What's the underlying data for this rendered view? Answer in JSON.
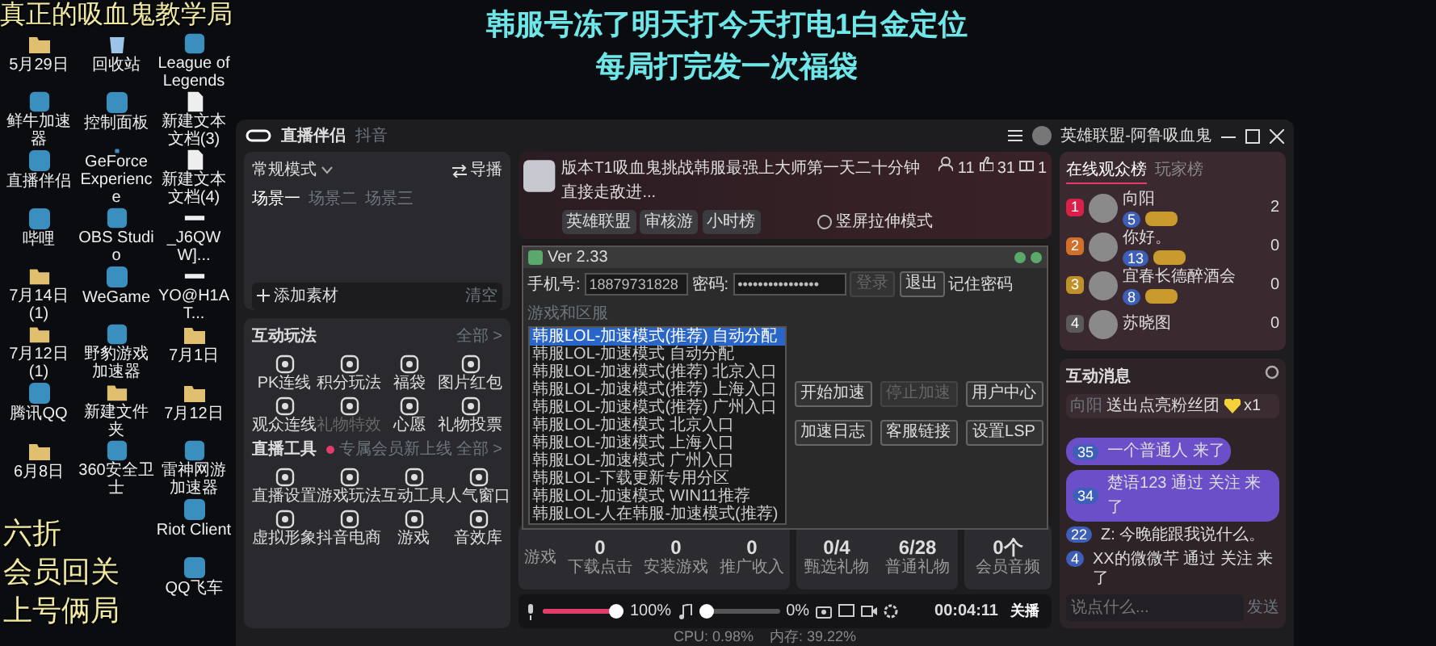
{
  "desktop": {
    "caption_top": "真正的吸血鬼教学局",
    "captions_bottom": [
      "六折",
      "会员回关",
      "上号俩局"
    ],
    "banner": [
      "韩服号冻了明天打今天打电1白金定位",
      "每局打完发一次福袋"
    ],
    "icon_columns": [
      [
        {
          "label": "5月29日",
          "kind": "folder"
        },
        {
          "label": "鲜牛加速器",
          "kind": "app"
        },
        {
          "label": "直播伴侣",
          "kind": "app"
        },
        {
          "label": "哔哩",
          "kind": "app"
        },
        {
          "label": "7月14日(1)",
          "kind": "folder"
        },
        {
          "label": "7月12日(1)",
          "kind": "folder"
        },
        {
          "label": "腾讯QQ",
          "kind": "app"
        },
        {
          "label": "6月8日",
          "kind": "folder"
        }
      ],
      [
        {
          "label": "回收站",
          "kind": "recycle"
        },
        {
          "label": "控制面板",
          "kind": "app"
        },
        {
          "label": "GeForce Experience",
          "kind": "app"
        },
        {
          "label": "OBS Studio",
          "kind": "app"
        },
        {
          "label": "WeGame",
          "kind": "app"
        },
        {
          "label": "野豹游戏加速器",
          "kind": "app"
        },
        {
          "label": "新建文件夹",
          "kind": "folder"
        },
        {
          "label": "360安全卫士",
          "kind": "app"
        }
      ],
      [
        {
          "label": "League of Legends",
          "kind": "app"
        },
        {
          "label": "新建文本文档(3)",
          "kind": "document"
        },
        {
          "label": "新建文本文档(4)",
          "kind": "document"
        },
        {
          "label": "_J6QWW]...",
          "kind": "file"
        },
        {
          "label": "YO@H1AT...",
          "kind": "file"
        },
        {
          "label": "7月1日",
          "kind": "folder"
        },
        {
          "label": "7月12日",
          "kind": "folder"
        },
        {
          "label": "雷神网游加速器",
          "kind": "app"
        },
        {
          "label": "Riot Client",
          "kind": "app"
        },
        {
          "label": "QQ飞车",
          "kind": "app"
        }
      ]
    ]
  },
  "app": {
    "title": "直播伴侣",
    "platform": "抖音",
    "room": "英雄联盟-阿鲁吸血鬼",
    "scene_card": {
      "mode": "常规模式",
      "director": "导播",
      "scenes": [
        {
          "label": "场景一",
          "selected": true
        },
        {
          "label": "场景二",
          "selected": false
        },
        {
          "label": "场景三",
          "selected": false
        }
      ],
      "add": "添加素材",
      "clear": "清空"
    },
    "interact": {
      "title": "互动玩法",
      "more": "全部 >",
      "items": [
        {
          "label": "PK连线",
          "disabled": false
        },
        {
          "label": "积分玩法",
          "disabled": false
        },
        {
          "label": "福袋",
          "disabled": false
        },
        {
          "label": "图片红包",
          "disabled": false
        },
        {
          "label": "观众连线",
          "disabled": false
        },
        {
          "label": "礼物特效",
          "disabled": true
        },
        {
          "label": "心愿",
          "disabled": false
        },
        {
          "label": "礼物投票",
          "disabled": false
        }
      ]
    },
    "tools": {
      "title": "直播工具",
      "notice": "专属会员新上线",
      "more": "全部 >",
      "items": [
        {
          "label": "直播设置"
        },
        {
          "label": "游戏玩法"
        },
        {
          "label": "互动工具"
        },
        {
          "label": "人气窗口"
        },
        {
          "label": "虚拟形象"
        },
        {
          "label": "抖音电商"
        },
        {
          "label": "游戏"
        },
        {
          "label": "音效库"
        }
      ]
    },
    "stream": {
      "title": "版本T1吸血鬼挑战韩服最强上大师第一天二十分钟直接走敌进...",
      "viewers": "11",
      "likes": "31",
      "gifts": "1",
      "tags": [
        "英雄联盟",
        "审核游",
        "小时榜"
      ],
      "portrait_mode": {
        "label": "竖屏拉伸模式",
        "checked": false
      }
    },
    "tool_window": {
      "title": "Ver 2.33",
      "phone_label": "手机号:",
      "phone": "18879731828",
      "password_label": "密码:",
      "password": "••••••••••••••••",
      "login_buttons": [
        {
          "label": "登录",
          "disabled": true
        },
        {
          "label": "退出",
          "disabled": false
        }
      ],
      "remember": "记住密码",
      "group": "游戏和区服",
      "servers": [
        {
          "label": "韩服LOL-加速模式(推荐) 自动分配",
          "selected": true
        },
        {
          "label": "韩服LOL-加速模式 自动分配",
          "selected": false
        },
        {
          "label": "韩服LOL-加速模式(推荐) 北京入口",
          "selected": false
        },
        {
          "label": "韩服LOL-加速模式(推荐) 上海入口",
          "selected": false
        },
        {
          "label": "韩服LOL-加速模式(推荐) 广州入口",
          "selected": false
        },
        {
          "label": "韩服LOL-加速模式 北京入口",
          "selected": false
        },
        {
          "label": "韩服LOL-加速模式 上海入口",
          "selected": false
        },
        {
          "label": "韩服LOL-加速模式 广州入口",
          "selected": false
        },
        {
          "label": "韩服LOL-下载更新专用分区",
          "selected": false
        },
        {
          "label": "韩服LOL-加速模式 WIN11推荐",
          "selected": false
        },
        {
          "label": "韩服LOL-人在韩服-加速模式(推荐)",
          "selected": false
        }
      ],
      "actions": [
        {
          "label": "开始加速",
          "disabled": false
        },
        {
          "label": "停止加速",
          "disabled": true
        },
        {
          "label": "用户中心",
          "disabled": false
        },
        {
          "label": "加速日志",
          "disabled": false
        },
        {
          "label": "客服链接",
          "disabled": false
        },
        {
          "label": "设置LSP",
          "disabled": false
        }
      ]
    },
    "stats": {
      "game_label": "游戏",
      "game": [
        {
          "value": "0",
          "label": "下载点击"
        },
        {
          "value": "0",
          "label": "安装游戏"
        },
        {
          "value": "0",
          "label": "推广收入"
        }
      ],
      "gifts": [
        {
          "value": "0",
          "total": "/4",
          "label": "甄选礼物"
        },
        {
          "value": "6",
          "total": "/28",
          "label": "普通礼物"
        }
      ],
      "member": {
        "value": "0",
        "unit": "个",
        "label": "会员音频"
      }
    },
    "controls": {
      "mic": {
        "level": 1,
        "reading": "100%"
      },
      "music": {
        "level": 0,
        "reading": "0%"
      },
      "timer": "00:04:11",
      "stop": "关播"
    },
    "ranking": {
      "tabs": [
        {
          "label": "在线观众榜",
          "selected": true
        },
        {
          "label": "玩家榜",
          "selected": false
        }
      ],
      "rows": [
        {
          "rank": "1",
          "name": "向阳",
          "level": "5",
          "score": "2",
          "color": "#d8204a"
        },
        {
          "rank": "2",
          "name": "你好。",
          "level": "13",
          "score": "0",
          "color": "#d0702a"
        },
        {
          "rank": "3",
          "name": "宜春长德醉酒会",
          "level": "8",
          "score": "0",
          "color": "#c0902a"
        },
        {
          "rank": "4",
          "name": "苏晓图",
          "level": "",
          "score": "0",
          "color": "#5a5a5a"
        }
      ]
    },
    "messages": {
      "title": "互动消息",
      "gift": {
        "user": "向阳",
        "text": "送出点亮粉丝团",
        "count": "x1"
      },
      "items": [
        {
          "kind": "bubble",
          "level": "35",
          "text": "一个普通人 来了"
        },
        {
          "kind": "bubble",
          "level": "34",
          "text": "楚语123 通过 关注 来了"
        },
        {
          "kind": "plain",
          "level": "22",
          "text": "Z: 今晚能跟我说什么。"
        },
        {
          "kind": "plain",
          "level": "4",
          "text": "XX的微微芊 通过 关注 来了"
        }
      ],
      "placeholder": "说点什么...",
      "send": "发送"
    },
    "status": [
      "CPU: 0.98%",
      "内存: 39.22%"
    ]
  }
}
